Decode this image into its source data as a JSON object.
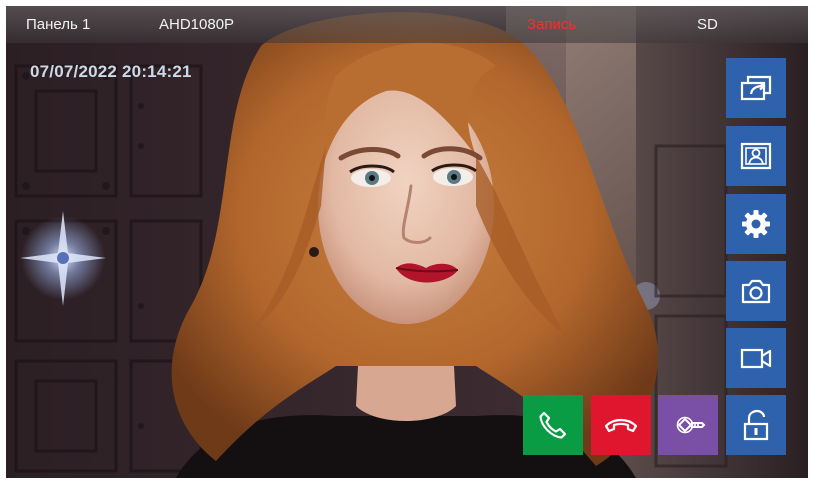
{
  "status_bar": {
    "panel": "Панель 1",
    "camera_mode": "AHD1080P",
    "recording": "Запись",
    "storage": "SD",
    "recording_color": "#ff2b2b"
  },
  "datetime": "07/07/2022 20:14:21",
  "side_buttons": [
    {
      "icon": "switch-view-icon",
      "action": "switch source"
    },
    {
      "icon": "photo-gallery-icon",
      "action": "gallery"
    },
    {
      "icon": "gear-icon",
      "action": "settings"
    },
    {
      "icon": "camera-icon",
      "action": "snapshot"
    },
    {
      "icon": "video-camera-icon",
      "action": "record video"
    },
    {
      "icon": "unlock-icon",
      "action": "unlock"
    }
  ],
  "call_buttons": [
    {
      "icon": "phone-answer-icon",
      "color": "#0a9b45"
    },
    {
      "icon": "phone-hangup-icon",
      "color": "#e0162e"
    },
    {
      "icon": "key-icon",
      "color": "#7a4fa6"
    }
  ],
  "colors": {
    "side_button": "#2f62ad",
    "datetime_text": "#ccd9e6"
  }
}
